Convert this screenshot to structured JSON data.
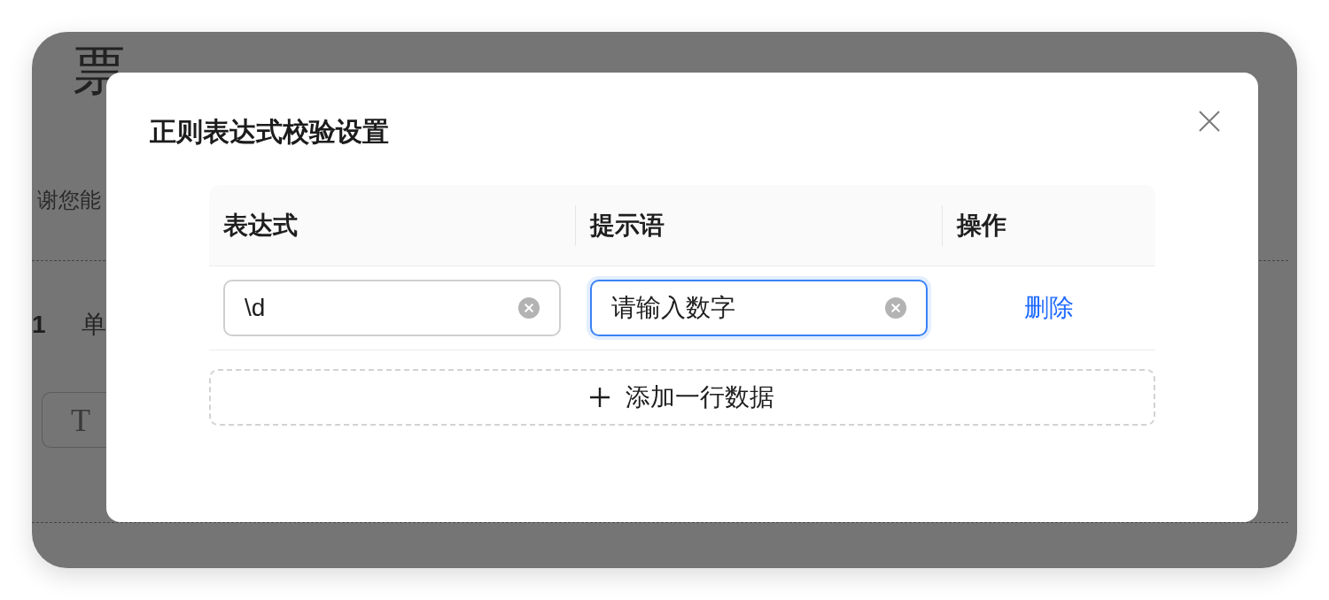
{
  "background_page": {
    "title": "票",
    "intro": "谢您能",
    "question": {
      "number": "1",
      "title": "单"
    },
    "tool_button": {
      "label": "T"
    }
  },
  "dialog": {
    "title": "正则表达式校验设置",
    "table": {
      "columns": [
        {
          "label": "表达式"
        },
        {
          "label": "提示语"
        },
        {
          "label": "操作"
        }
      ],
      "rows": [
        {
          "expression": {
            "value": "\\d",
            "focused": false
          },
          "hint": {
            "value": "请输入数字",
            "focused": true
          },
          "action": "删除"
        }
      ]
    },
    "add_button": {
      "label": "添加一行数据"
    }
  }
}
